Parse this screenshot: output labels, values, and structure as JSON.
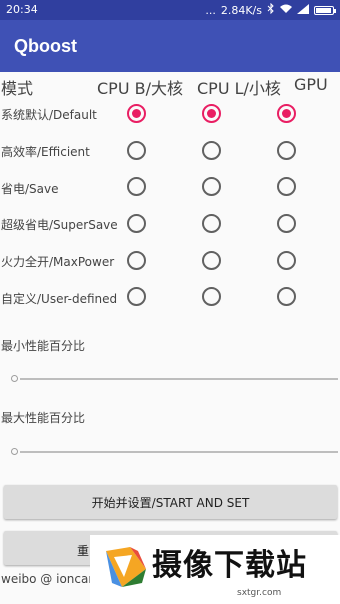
{
  "statusbar": {
    "time": "20:34",
    "dots": "...",
    "speed": "2.84K/s",
    "battery_level": 0.95
  },
  "app": {
    "title": "Qboost"
  },
  "columns": {
    "mode": "模式",
    "cpu_big": "CPU B/大核",
    "cpu_little": "CPU L/小核",
    "gpu": "GPU"
  },
  "modes": [
    {
      "label": "系统默认/Default",
      "selected": true
    },
    {
      "label": "高效率/Efficient",
      "selected": false
    },
    {
      "label": "省电/Save",
      "selected": false
    },
    {
      "label": "超级省电/SuperSave",
      "selected": false
    },
    {
      "label": "火力全开/MaxPower",
      "selected": false
    },
    {
      "label": "自定义/User-defined",
      "selected": false
    }
  ],
  "seekbars": {
    "min_label": "最小性能百分比",
    "max_label": "最大性能百分比",
    "min_value": 0,
    "max_value": 0
  },
  "buttons": {
    "start": "开始并设置/START AND SET",
    "second_visible": "重"
  },
  "footer": {
    "text": "weibo @ ioncar"
  },
  "watermark": {
    "title": "摄像下载站",
    "url": "sxtgr.com"
  },
  "colors": {
    "appbar": "#3f51b5",
    "statusbar": "#303f9f",
    "accent": "#e91e63"
  }
}
